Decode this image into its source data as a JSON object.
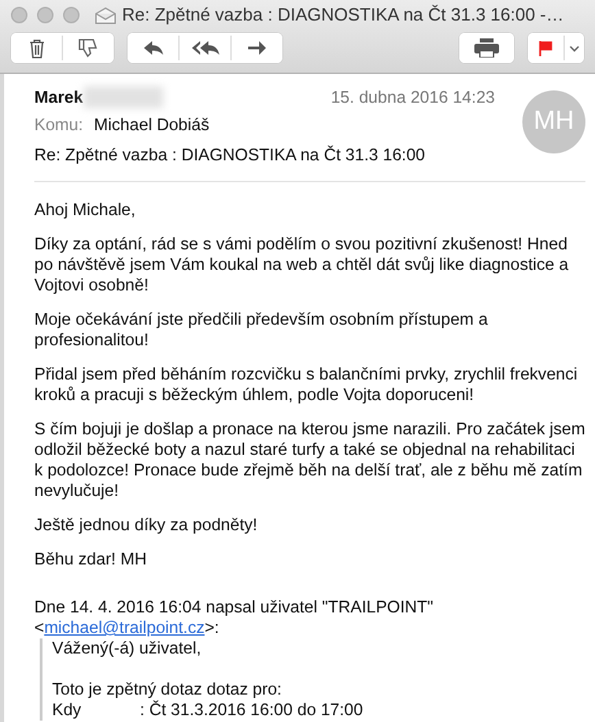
{
  "window": {
    "title": "Re: Zpětné vazba : DIAGNOSTIKA na Čt 31.3 16:00 -…"
  },
  "toolbar": {
    "flagged": true
  },
  "header": {
    "sender": "Marek",
    "date": "15. dubna 2016 14:23",
    "to_label": "Komu:",
    "to": "Michael Dobiáš",
    "subject": "Re: Zpětné vazba : DIAGNOSTIKA na Čt 31.3 16:00",
    "avatar": "MH"
  },
  "body": {
    "paragraphs": [
      "Ahoj Michale,",
      "Díky za optání, rád se s vámi podělím o svou pozitivní zkušenost! Hned po návštěvě jsem Vám koukal na web a chtěl dát svůj like diagnostice a Vojtovi osobně!",
      "Moje očekávání jste předčili především osobním přístupem a profesionalitou!",
      "Přidal jsem před běháním rozcvičku s balančními prvky, zrychlil frekvenci kroků a pracuji s běžeckým úhlem, podle Vojta doporuceni!",
      "S čím bojuji je došlap a pronace na kterou jsme narazili. Pro začátek jsem odložil běžecké boty a nazul staré turfy a také se objednal na rehabilitaci k podolozce! Pronace bude zřejmě běh na delší trať, ale z běhu mě zatím nevylučuje!",
      "Ještě jednou díky za podněty!",
      "Běhu zdar! MH"
    ],
    "attribution": "Dne 14. 4. 2016 16:04 napsal uživatel \"TRAILPOINT\"",
    "email_open": "<",
    "email": "michael@trailpoint.cz",
    "email_close": ">:",
    "quote": {
      "greeting": "Vážený(-á) uživatel,",
      "intro": "Toto je zpětný dotaz dotaz pro:",
      "rows": [
        {
          "label": "Kdy",
          "value": ": Čt 31.3.2016 16:00 do 17:00"
        }
      ]
    }
  }
}
